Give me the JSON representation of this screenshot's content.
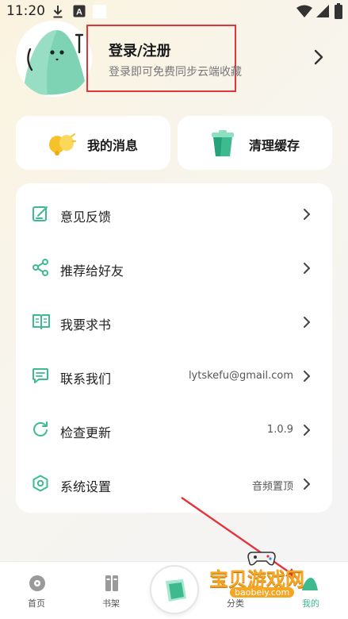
{
  "status_bar": {
    "time": "11:20",
    "download_icon": "download-icon",
    "a_icon": "text-a-icon"
  },
  "profile": {
    "title": "登录/注册",
    "subtitle": "登录即可免费同步云端收藏"
  },
  "quick_actions": [
    {
      "label": "我的消息",
      "icon": "bell-icon"
    },
    {
      "label": "清理缓存",
      "icon": "trash-icon"
    }
  ],
  "menu": [
    {
      "label": "意见反馈",
      "value": "",
      "icon": "edit-icon"
    },
    {
      "label": "推荐给好友",
      "value": "",
      "icon": "share-icon"
    },
    {
      "label": "我要求书",
      "value": "",
      "icon": "book-icon"
    },
    {
      "label": "联系我们",
      "value": "lytskefu@gmail.com",
      "icon": "chat-icon"
    },
    {
      "label": "检查更新",
      "value": "1.0.9",
      "icon": "refresh-icon"
    },
    {
      "label": "系统设置",
      "value": "音频置顶",
      "icon": "settings-icon"
    }
  ],
  "tabs": [
    {
      "label": "首页",
      "icon": "home-disc-icon"
    },
    {
      "label": "书架",
      "icon": "bookshelf-icon"
    },
    {
      "label": "分类",
      "icon": "category-icon"
    },
    {
      "label": "我的",
      "icon": "profile-icon"
    }
  ],
  "watermark": {
    "title": "宝贝游戏网",
    "url": "baobeiy.com"
  },
  "colors": {
    "accent": "#3dbb8f",
    "accent_light": "#a9e6cf",
    "highlight_box": "#e0353b",
    "bell": "#f6c22a"
  }
}
